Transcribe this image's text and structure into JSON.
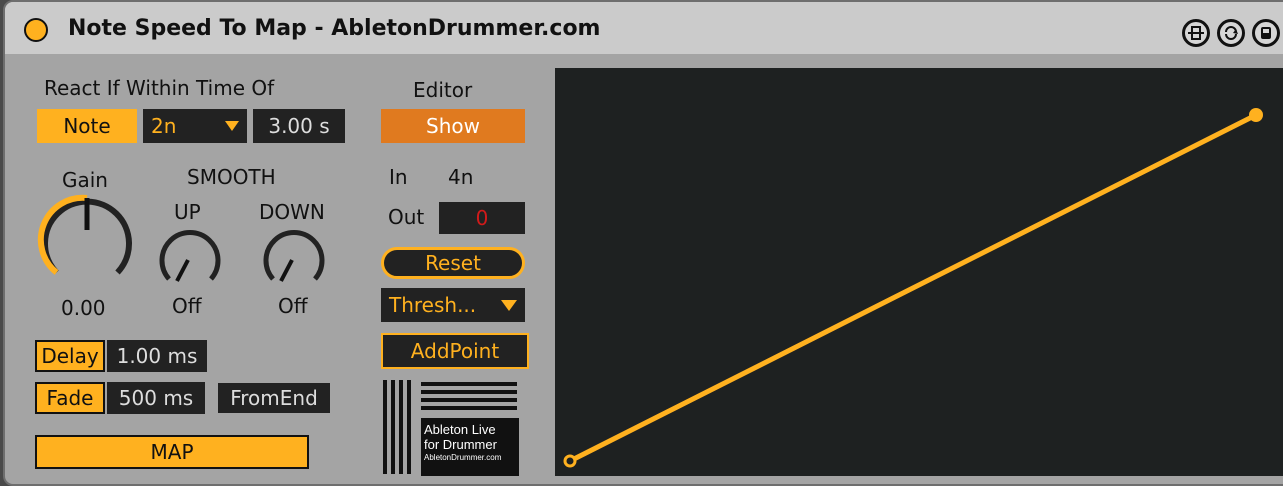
{
  "title": "Note Speed To Map - AbletonDrummer.com",
  "react": {
    "heading": "React If Within Time Of",
    "mode_label": "Note",
    "interval_value": "2n",
    "time_value": "3.00 s"
  },
  "gain": {
    "label": "Gain",
    "value": "0.00"
  },
  "smooth": {
    "heading": "SMOOTH",
    "up_label": "UP",
    "up_value": "Off",
    "down_label": "DOWN",
    "down_value": "Off"
  },
  "delay": {
    "label": "Delay",
    "value": "1.00 ms"
  },
  "fade": {
    "label": "Fade",
    "value": "500 ms",
    "from_end_label": "FromEnd"
  },
  "map_label": "MAP",
  "editor": {
    "heading": "Editor",
    "show_label": "Show",
    "in_label": "In",
    "in_value": "4n",
    "out_label": "Out",
    "out_value": "0",
    "reset_label": "Reset",
    "thresh_label": "Thresh...",
    "addpoint_label": "AddPoint"
  },
  "logo": {
    "line1": "Ableton Live",
    "line2": "for Drummer",
    "line3": "AbletonDrummer.com"
  },
  "colors": {
    "accent": "#ffb11f",
    "show_button": "#e07a1f",
    "out_value": "#d11a1a",
    "editor_bg": "#1e2121"
  }
}
